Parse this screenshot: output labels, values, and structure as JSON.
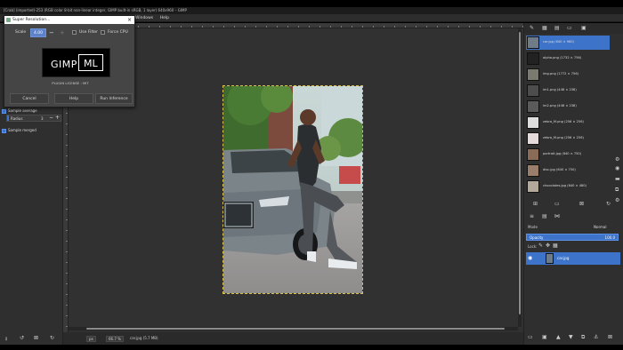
{
  "window": {
    "title": "[Crab] (imported)-253 (RGB color 8-bit non-linear integer, GIMP built-in sRGB, 1 layer) 640x960 – GIMP"
  },
  "menu": {
    "left": [
      "File"
    ],
    "right": [
      "Windows",
      "Help"
    ]
  },
  "dialog": {
    "title": "Super Resolution...",
    "scale_label": "Scale",
    "scale_value": "4.00",
    "minus": "−",
    "plus": "+",
    "use_filter_label": "Use Filter",
    "force_cpu_label": "Force CPU",
    "logo_left": "GIMP",
    "logo_right": "ML",
    "license": "PLUGIN LICENSE : MIT",
    "cancel_label": "Cancel",
    "help_label": "Help",
    "run_label": "Run Inference"
  },
  "tool_options": {
    "sample_average_label": "Sample average",
    "radius_label": "Radius",
    "radius_value": "3",
    "sample_merged_label": "Sample merged"
  },
  "status": {
    "unit": "px",
    "zoom": "66.7 %",
    "file": "car.jpg (5.7 MB)"
  },
  "images": [
    {
      "label": "car.jpg (640 × 960)",
      "active": true
    },
    {
      "label": "alpha.png (1732 × 756)",
      "active": false
    },
    {
      "label": "img.png (1772 × 756)",
      "active": false
    },
    {
      "label": "im1.png (448 × 238)",
      "active": false
    },
    {
      "label": "im2.png (448 × 238)",
      "active": false
    },
    {
      "label": "zebra_M.png (256 × 256)",
      "active": false
    },
    {
      "label": "zebra_M.png (256 × 256)",
      "active": false
    },
    {
      "label": "portrait.jpg (640 × 750)",
      "active": false
    },
    {
      "label": "disc.jpg (640 × 750)",
      "active": false
    },
    {
      "label": "chocolates.jpg (640 × 480)",
      "active": false
    }
  ],
  "layers": {
    "mode_label": "Mode",
    "mode_value": "Normal",
    "opacity_label": "Opacity",
    "opacity_value": "100.0",
    "lock_label": "Lock:",
    "items": [
      {
        "name": "car.jpg"
      }
    ]
  },
  "colors": {
    "accent": "#3d74c9",
    "selection": "#d8c04a"
  }
}
